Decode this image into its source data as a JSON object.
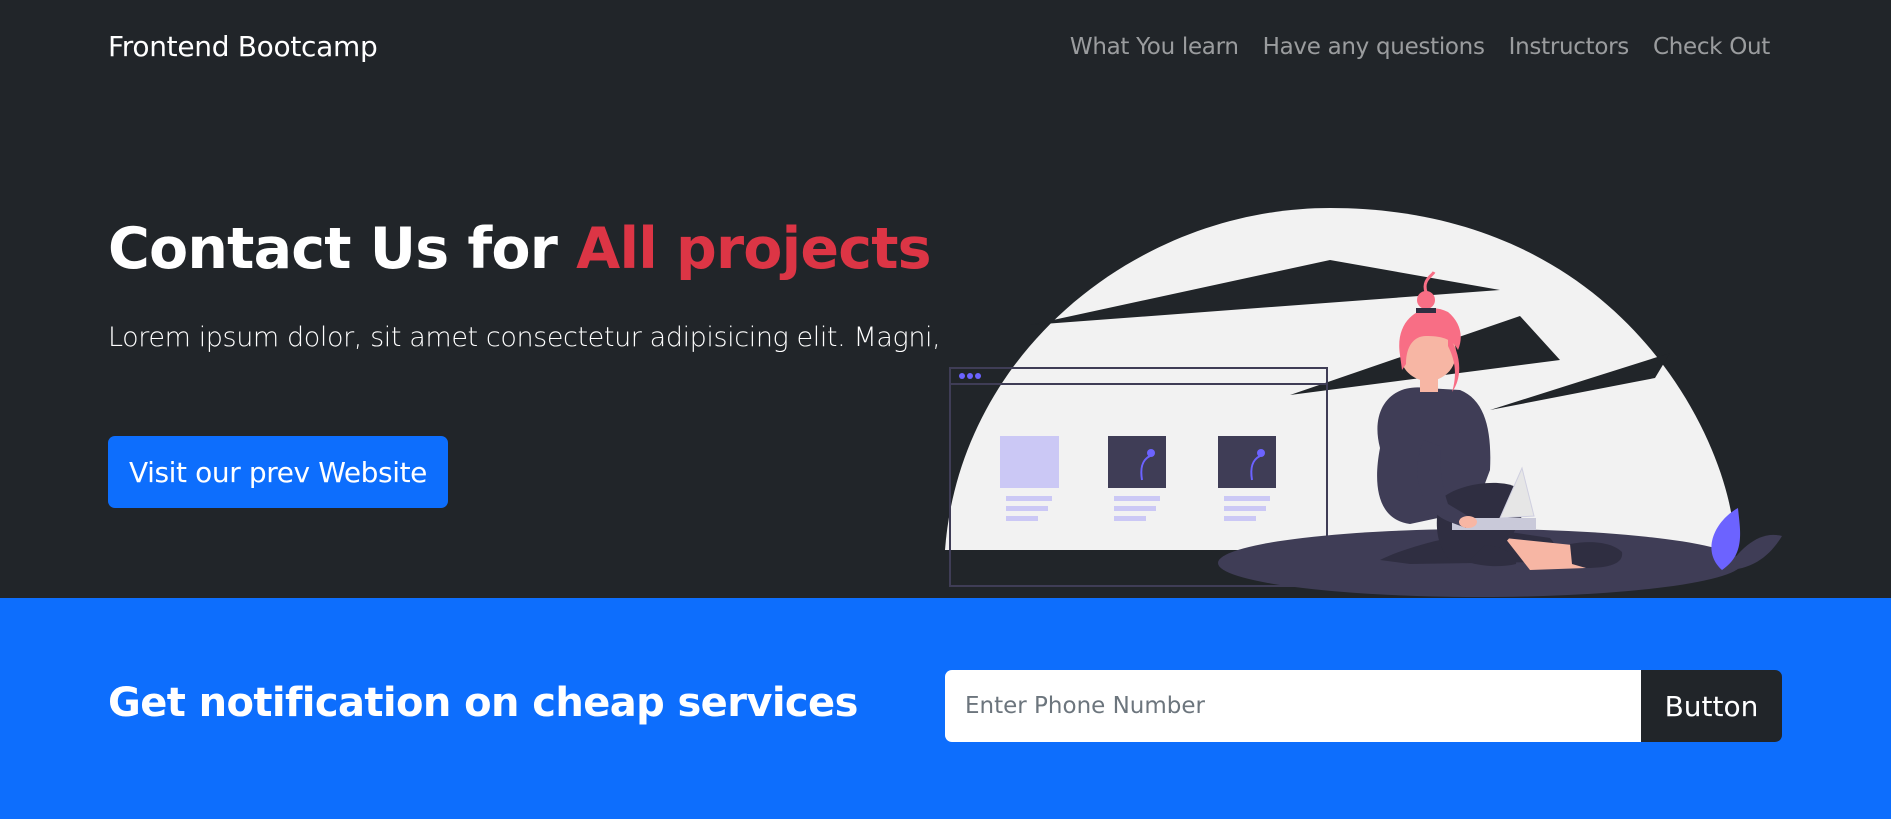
{
  "navbar": {
    "brand": "Frontend Bootcamp",
    "links": [
      {
        "label": "What You learn"
      },
      {
        "label": "Have any questions"
      },
      {
        "label": "Instructors"
      },
      {
        "label": "Check Out"
      }
    ]
  },
  "hero": {
    "title_main": "Contact Us for ",
    "title_accent": "All projects",
    "lead": "Lorem ipsum dolor, sit amet consectetur adipisicing elit. Magni,",
    "button_label": "Visit our prev Website",
    "illustration_icon": "person-with-laptop-illustration"
  },
  "newsletter": {
    "title": "Get notification on cheap services",
    "input_placeholder": "Enter Phone Number",
    "input_value": "",
    "button_label": "Button"
  },
  "colors": {
    "dark_bg": "#212529",
    "primary": "#0d6efd",
    "accent": "#dc3545",
    "nav_text": "rgba(255,255,255,0.55)",
    "illustration_purple": "#6c63ff",
    "illustration_hair": "#f86e85"
  }
}
